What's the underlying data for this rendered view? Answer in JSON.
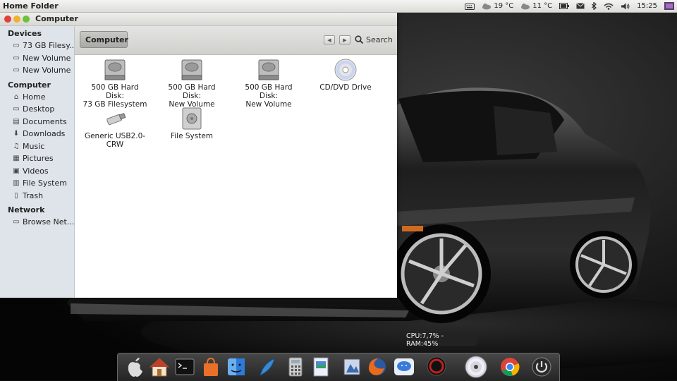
{
  "top_panel": {
    "window_title": "Home Folder",
    "weather1": "19 °C",
    "weather2": "11 °C",
    "clock": "15:25",
    "icons": [
      "keyboard-icon",
      "cloud-icon",
      "cloud-icon",
      "battery-icon",
      "mail-icon",
      "bluetooth-icon",
      "wifi-icon",
      "volume-icon",
      "user-icon"
    ]
  },
  "window": {
    "title": "Computer",
    "toolbar": {
      "location": "Computer",
      "search": "Search"
    },
    "sidebar": {
      "sections": [
        {
          "heading": "Devices",
          "items": [
            {
              "label": "73 GB Filesy...",
              "icon": "drive-icon"
            },
            {
              "label": "New Volume",
              "icon": "drive-icon"
            },
            {
              "label": "New Volume",
              "icon": "drive-icon"
            }
          ]
        },
        {
          "heading": "Computer",
          "items": [
            {
              "label": "Home",
              "icon": "home-icon"
            },
            {
              "label": "Desktop",
              "icon": "desktop-icon"
            },
            {
              "label": "Documents",
              "icon": "documents-icon"
            },
            {
              "label": "Downloads",
              "icon": "downloads-icon"
            },
            {
              "label": "Music",
              "icon": "music-icon"
            },
            {
              "label": "Pictures",
              "icon": "pictures-icon"
            },
            {
              "label": "Videos",
              "icon": "videos-icon"
            },
            {
              "label": "File System",
              "icon": "filesystem-icon"
            },
            {
              "label": "Trash",
              "icon": "trash-icon"
            }
          ]
        },
        {
          "heading": "Network",
          "items": [
            {
              "label": "Browse Net...",
              "icon": "network-icon"
            }
          ]
        }
      ]
    },
    "items": [
      {
        "line1": "500 GB Hard Disk:",
        "line2": "73 GB Filesystem",
        "icon": "harddisk-icon"
      },
      {
        "line1": "500 GB Hard Disk:",
        "line2": "New Volume",
        "icon": "harddisk-icon"
      },
      {
        "line1": "500 GB Hard Disk:",
        "line2": "New Volume",
        "icon": "harddisk-icon"
      },
      {
        "line1": "CD/DVD Drive",
        "line2": "",
        "icon": "cd-icon"
      },
      {
        "line1": "Generic USB2.0-",
        "line2": "CRW",
        "icon": "usb-icon"
      },
      {
        "line1": "File System",
        "line2": "",
        "icon": "filesystem-icon"
      }
    ]
  },
  "dock": {
    "tooltip": "CPU:7,7% - RAM:45%",
    "icons": [
      "apple-icon",
      "home-icon",
      "terminal-icon",
      "shopping-bag-icon",
      "finder-icon",
      "quill-icon",
      "calculator-icon",
      "image-viewer-icon",
      "photos-icon",
      "firefox-icon",
      "messages-icon",
      "system-monitor-icon",
      "disc-icon",
      "chrome-icon",
      "power-icon"
    ]
  }
}
